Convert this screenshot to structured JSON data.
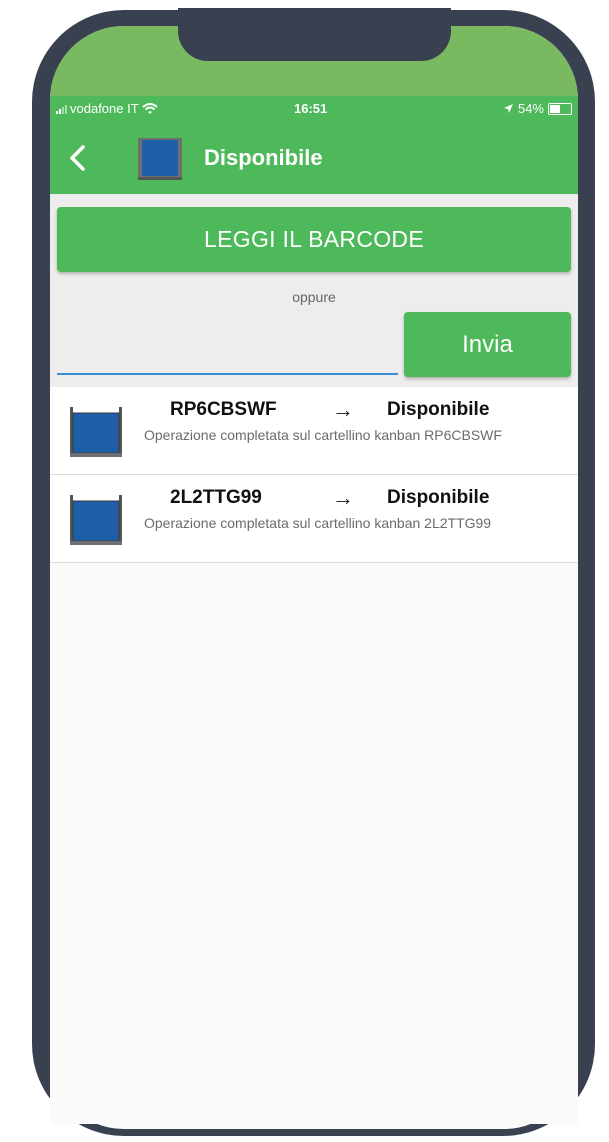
{
  "status_bar": {
    "carrier": "vodafone IT",
    "time": "16:51",
    "battery": "54%"
  },
  "app_bar": {
    "title": "Disponibile",
    "icons": [
      "back-chevron-icon",
      "kanban-container-icon"
    ]
  },
  "actions": {
    "scan_button_label": "LEGGI IL BARCODE",
    "separator": "oppure",
    "code_input_value": "",
    "send_button_label": "Invia"
  },
  "results": [
    {
      "code": "RP6CBSWF",
      "arrow": "→",
      "status": "Disponibile",
      "message": "Operazione completata sul cartellino kanban RP6CBSWF"
    },
    {
      "code": "2L2TTG99",
      "arrow": "→",
      "status": "Disponibile",
      "message": "Operazione completata sul cartellino kanban 2L2TTG99"
    }
  ],
  "colors": {
    "primary_green": "#4eb95a",
    "light_green": "#79b960",
    "frame": "#394150",
    "kanban_blue": "#1f5fa8",
    "input_underline": "#3c8fd6"
  }
}
